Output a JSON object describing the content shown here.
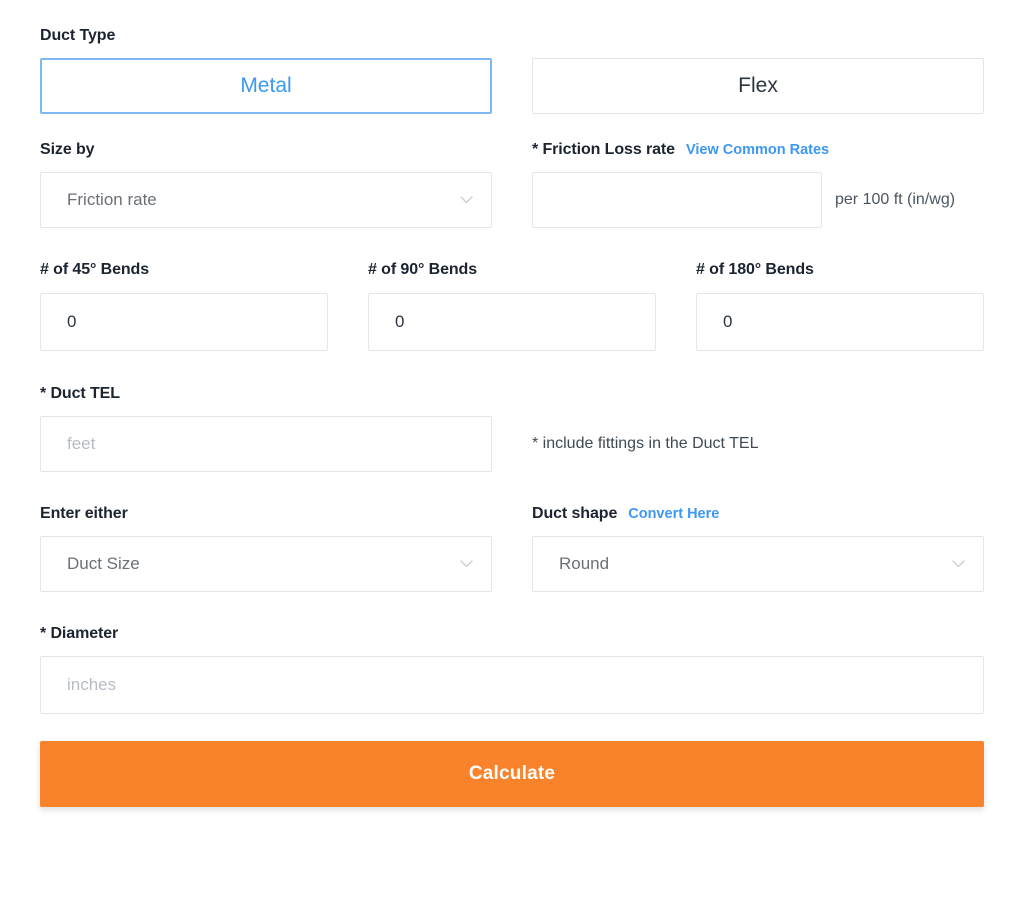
{
  "duct_type": {
    "label": "Duct Type",
    "options": [
      {
        "label": "Metal",
        "selected": true
      },
      {
        "label": "Flex",
        "selected": false
      }
    ]
  },
  "size_by": {
    "label": "Size by",
    "selected": "Friction rate",
    "chevron_icon": "chevron-down-icon"
  },
  "friction_loss": {
    "label": "* Friction Loss rate",
    "link": "View Common Rates",
    "value": "",
    "unit": "per 100 ft (in/wg)"
  },
  "bends": [
    {
      "label": "# of 45° Bends",
      "value": "0"
    },
    {
      "label": "# of 90° Bends",
      "value": "0"
    },
    {
      "label": "# of 180° Bends",
      "value": "0"
    }
  ],
  "duct_tel": {
    "label": "* Duct TEL",
    "placeholder": "feet",
    "value": "",
    "note": "* include fittings in the Duct TEL"
  },
  "enter_either": {
    "label": "Enter either",
    "selected": "Duct Size",
    "chevron_icon": "chevron-down-icon"
  },
  "duct_shape": {
    "label": "Duct shape",
    "link": "Convert Here",
    "selected": "Round",
    "chevron_icon": "chevron-down-icon"
  },
  "diameter": {
    "label": "* Diameter",
    "placeholder": "inches",
    "value": ""
  },
  "submit": {
    "label": "Calculate"
  },
  "colors": {
    "accent_blue": "#3c97f5",
    "accent_blue_border": "#7fb8f5",
    "orange": "#f9832a",
    "text_dark": "#1b2430",
    "border_gray": "#e4e6e8",
    "placeholder_gray": "#b6bcc4"
  }
}
